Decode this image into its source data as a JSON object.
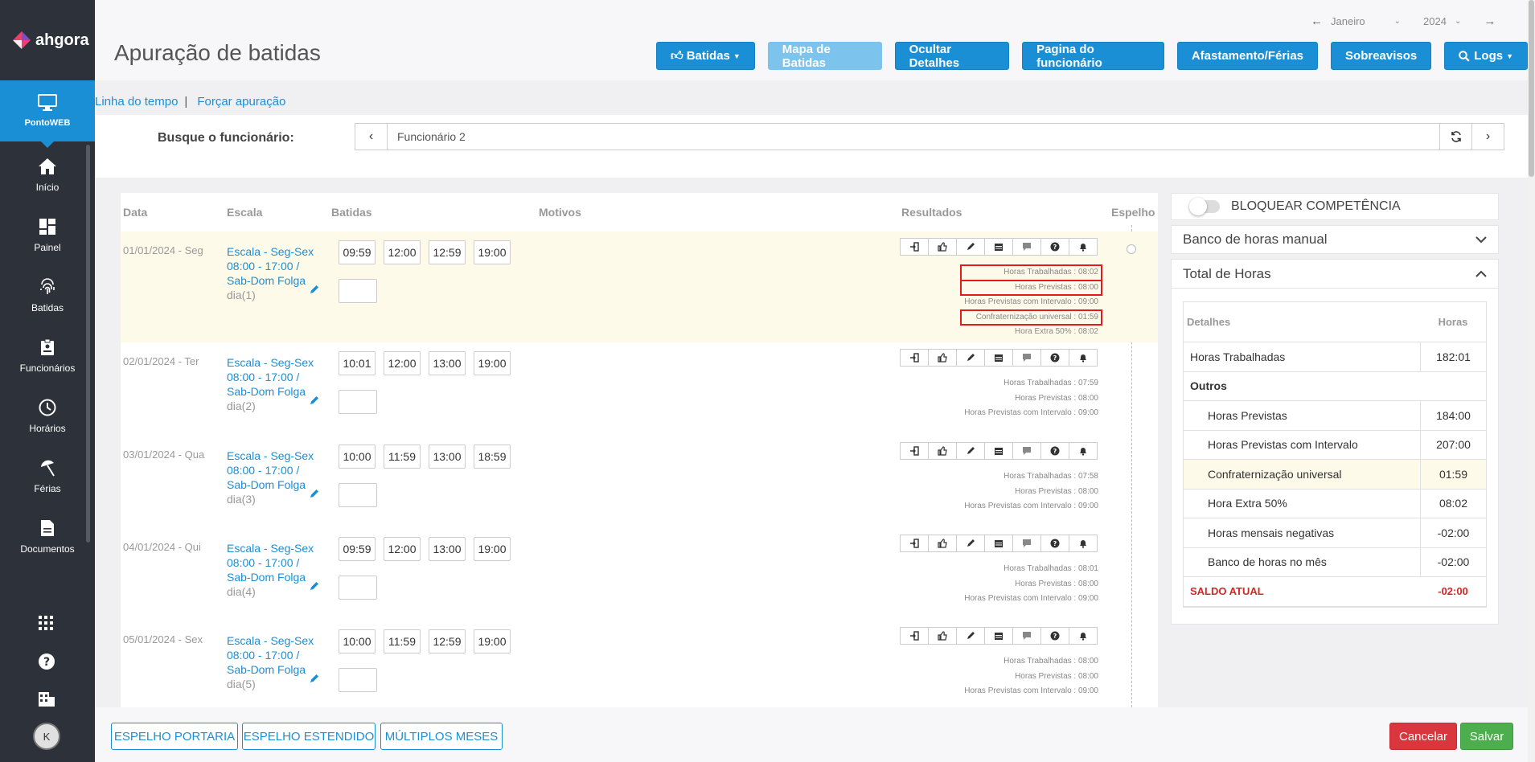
{
  "app": {
    "name": "ahgora"
  },
  "sidebar": {
    "active": "PontoWEB",
    "items": [
      {
        "label": "Início",
        "icon": "home-icon"
      },
      {
        "label": "Painel",
        "icon": "dashboard-icon"
      },
      {
        "label": "Batidas",
        "icon": "fingerprint-icon"
      },
      {
        "label": "Funcionários",
        "icon": "badge-icon"
      },
      {
        "label": "Horários",
        "icon": "clock-icon"
      },
      {
        "label": "Férias",
        "icon": "umbrella-icon"
      },
      {
        "label": "Documentos",
        "icon": "document-icon"
      }
    ],
    "avatar": "K"
  },
  "header": {
    "title": "Apuração de batidas",
    "month": "Janeiro",
    "year": "2024",
    "buttons": {
      "batidas": "Batidas",
      "mapa": "Mapa de Batidas",
      "ocultar": "Ocultar Detalhes",
      "pagina": "Pagina do funcionário",
      "afastamento": "Afastamento/Férias",
      "sobreavisos": "Sobreavisos",
      "logs": "Logs"
    }
  },
  "links": {
    "timeline": "Linha do tempo",
    "separator": "|",
    "forcar": "Forçar apuração"
  },
  "search": {
    "label": "Busque o funcionário:",
    "value": "Funcionário 2"
  },
  "table": {
    "headers": {
      "data": "Data",
      "escala": "Escala",
      "batidas": "Batidas",
      "motivos": "Motivos",
      "resultados": "Resultados",
      "espelho": "Espelho"
    },
    "rows": [
      {
        "date": "01/01/2024 - Seg",
        "escala": "Escala - Seg-Sex 08:00 - 17:00 / Sab-Dom Folga",
        "dia": "dia(1)",
        "punches": [
          "09:59",
          "12:00",
          "12:59",
          "19:00"
        ],
        "results": [
          "Horas Trabalhadas : 08:02",
          "Horas Previstas : 08:00",
          "Horas Previstas com Intervalo : 09:00",
          "Confraternização universal : 01:59",
          "Hora Extra 50% : 08:02"
        ]
      },
      {
        "date": "02/01/2024 - Ter",
        "escala": "Escala - Seg-Sex 08:00 - 17:00 / Sab-Dom Folga",
        "dia": "dia(2)",
        "punches": [
          "10:01",
          "12:00",
          "13:00",
          "19:00"
        ],
        "results": [
          "Horas Trabalhadas : 07:59",
          "Horas Previstas : 08:00",
          "Horas Previstas com Intervalo : 09:00"
        ]
      },
      {
        "date": "03/01/2024 - Qua",
        "escala": "Escala - Seg-Sex 08:00 - 17:00 / Sab-Dom Folga",
        "dia": "dia(3)",
        "punches": [
          "10:00",
          "11:59",
          "13:00",
          "18:59"
        ],
        "results": [
          "Horas Trabalhadas : 07:58",
          "Horas Previstas : 08:00",
          "Horas Previstas com Intervalo : 09:00"
        ]
      },
      {
        "date": "04/01/2024 - Qui",
        "escala": "Escala - Seg-Sex 08:00 - 17:00 / Sab-Dom Folga",
        "dia": "dia(4)",
        "punches": [
          "09:59",
          "12:00",
          "13:00",
          "19:00"
        ],
        "results": [
          "Horas Trabalhadas : 08:01",
          "Horas Previstas : 08:00",
          "Horas Previstas com Intervalo : 09:00"
        ]
      },
      {
        "date": "05/01/2024 - Sex",
        "escala": "Escala - Seg-Sex 08:00 - 17:00 / Sab-Dom Folga",
        "dia": "dia(5)",
        "punches": [
          "10:00",
          "11:59",
          "12:59",
          "19:00"
        ],
        "results": [
          "Horas Trabalhadas : 08:00",
          "Horas Previstas : 08:00",
          "Horas Previstas com Intervalo : 09:00"
        ]
      }
    ]
  },
  "right": {
    "bloquear": "BLOQUEAR COMPETÊNCIA",
    "banco": "Banco de horas manual",
    "total": "Total de Horas",
    "headers": {
      "detalhes": "Detalhes",
      "horas": "Horas"
    },
    "rows": [
      {
        "label": "Horas Trabalhadas",
        "value": "182:01"
      },
      {
        "label": "Outros",
        "value": ""
      },
      {
        "label": "Horas Previstas",
        "value": "184:00"
      },
      {
        "label": "Horas Previstas com Intervalo",
        "value": "207:00"
      },
      {
        "label": "Confraternização universal",
        "value": "01:59"
      },
      {
        "label": "Hora Extra 50%",
        "value": "08:02"
      },
      {
        "label": "Horas mensais negativas",
        "value": "-02:00"
      },
      {
        "label": "Banco de horas no mês",
        "value": "-02:00"
      },
      {
        "label": "SALDO ATUAL",
        "value": "-02:00"
      }
    ]
  },
  "footer": {
    "portaria": "ESPELHO PORTARIA",
    "estendido": "ESPELHO ESTENDIDO",
    "multiplos": "MÚLTIPLOS MESES",
    "cancelar": "Cancelar",
    "salvar": "Salvar"
  },
  "colors": {
    "primary": "#1a8fd6",
    "sidebar": "#2d3139",
    "highlight": "#fdfae9",
    "danger": "#d9363e",
    "success": "#4cae4c"
  }
}
